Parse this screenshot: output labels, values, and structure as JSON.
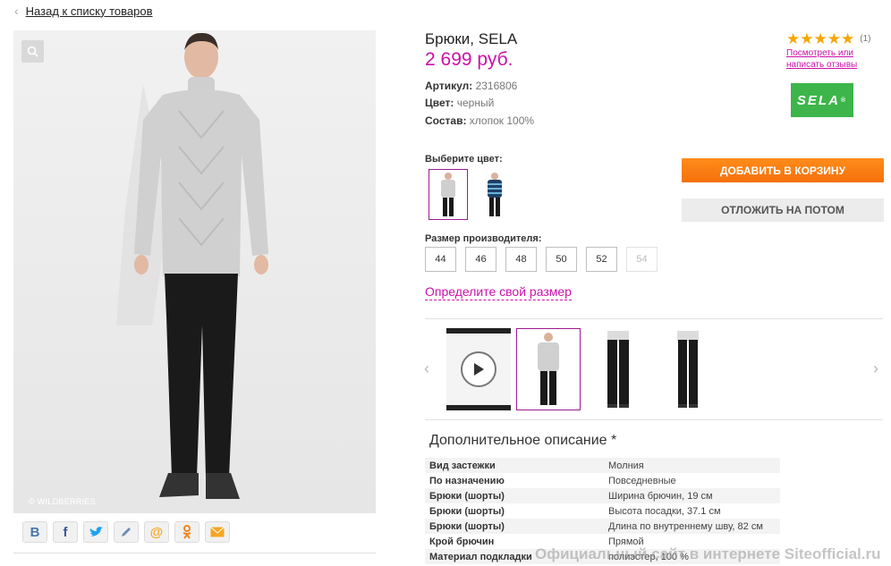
{
  "nav": {
    "back_label": "Назад к списку товаров"
  },
  "photo": {
    "watermark": "© WILDBERRIES",
    "zoom_icon": "magnifier-icon"
  },
  "share": [
    "В",
    "f",
    "twitter",
    "pencil",
    "@",
    "ok",
    "mail"
  ],
  "product": {
    "title": "Брюки, SELA",
    "price": "2 699 руб.",
    "article_label": "Артикул:",
    "article_value": "2316806",
    "color_label": "Цвет:",
    "color_value": "черный",
    "composition_label": "Состав:",
    "composition_value": "хлопок 100%"
  },
  "rating": {
    "stars": 5,
    "count": "(1)",
    "reviews_link": "Посмотреть или написать отзывы"
  },
  "brand": {
    "logo_text": "SELA",
    "color": "#3db54a"
  },
  "choose_color_label": "Выберите цвет:",
  "size_label": "Размер производителя:",
  "sizes": [
    {
      "value": "44",
      "available": true
    },
    {
      "value": "46",
      "available": true
    },
    {
      "value": "48",
      "available": true
    },
    {
      "value": "50",
      "available": true
    },
    {
      "value": "52",
      "available": true
    },
    {
      "value": "54",
      "available": false
    }
  ],
  "size_guide": "Определите свой размер",
  "actions": {
    "add_to_cart": "ДОБАВИТЬ В КОРЗИНУ",
    "save_later": "ОТЛОЖИТЬ НА ПОТОМ"
  },
  "description": {
    "title": "Дополнительное описание *",
    "rows": [
      {
        "k": "Вид застежки",
        "v": "Молния"
      },
      {
        "k": "По назначению",
        "v": "Повседневные"
      },
      {
        "k": "Брюки (шорты)",
        "v": "Ширина брючин, 19 см"
      },
      {
        "k": "Брюки (шорты)",
        "v": "Высота посадки, 37.1 см"
      },
      {
        "k": "Брюки (шорты)",
        "v": "Длина по внутреннему шву, 82 см"
      },
      {
        "k": "Крой брючин",
        "v": "Прямой"
      },
      {
        "k": "Материал подкладки",
        "v": "полиэстер, 100 %"
      }
    ]
  },
  "site_watermark": "Официальный сайт в интернете Siteofficial.ru",
  "colors": {
    "accent": "#cb11ab",
    "cart": "#f5700a",
    "selected_border": "#9c1b8e"
  }
}
